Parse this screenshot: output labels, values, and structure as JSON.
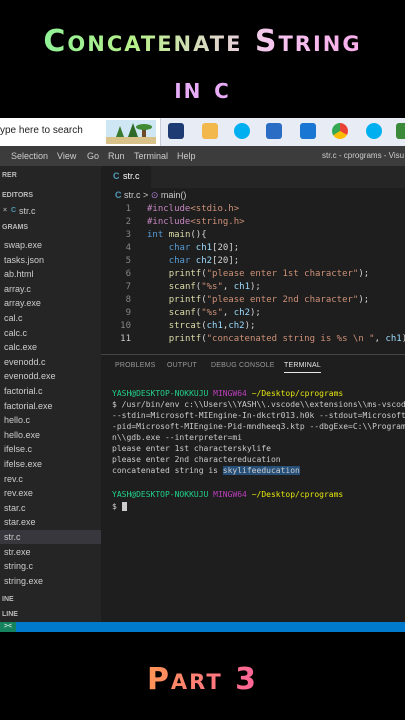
{
  "overlay": {
    "title_line1": "Concatenate String",
    "title_line2": "in c",
    "footer": "Part 3"
  },
  "taskbar": {
    "search_placeholder": "ype here to search",
    "icons": [
      "task-view-icon",
      "file-explorer-icon",
      "skype-icon",
      "calendar-icon",
      "mail-icon",
      "chrome-icon",
      "skype-icon",
      "app-icon"
    ]
  },
  "menubar": {
    "items": [
      "Selection",
      "View",
      "Go",
      "Run",
      "Terminal",
      "Help"
    ],
    "window_title": "str.c - cprograms - Visu"
  },
  "sidebar": {
    "header": "RER",
    "open_editors": "EDITORS",
    "open_file": "str.c",
    "folder": "GRAMS",
    "files": [
      "swap.exe",
      "tasks.json",
      "ab.html",
      "array.c",
      "array.exe",
      "cal.c",
      "calc.c",
      "calc.exe",
      "evenodd.c",
      "evenodd.exe",
      "factorial.c",
      "factorial.exe",
      "hello.c",
      "hello.exe",
      "ifelse.c",
      "ifelse.exe",
      "rev.c",
      "rev.exe",
      "star.c",
      "star.exe",
      "str.c",
      "str.exe",
      "string.c",
      "string.exe"
    ],
    "outline": "INE",
    "timeline": "LINE"
  },
  "editor": {
    "tab_label": "str.c",
    "breadcrumb_file": "str.c",
    "breadcrumb_sep": ">",
    "breadcrumb_symbol": "main()",
    "lines": [
      "8",
      "9",
      "10",
      "11"
    ]
  },
  "panel": {
    "tabs": [
      "PROBLEMS",
      "OUTPUT",
      "DEBUG CONSOLE",
      "TERMINAL"
    ]
  },
  "terminal": {
    "prompt_user": "YASH@DESKTOP-NOKKUJU",
    "prompt_shell": "MINGW64",
    "prompt_path": "~/Desktop/cprograms",
    "cmd1": "$ /usr/bin/env c:\\\\Users\\\\YASH\\\\.vscode\\\\extensions\\\\ms-vscod",
    "cmd2": "--stdin=Microsoft-MIEngine-In-dkctr013.h0k --stdout=Microsoft-",
    "cmd3": "-pid=Microsoft-MIEngine-Pid-mndheeq3.ktp --dbgExe=C:\\\\Program\\",
    "cmd4": "n\\\\gdb.exe --interpreter=mi",
    "out1": "please enter 1st characterskylife",
    "out2": "please enter 2nd charactereducation",
    "out3_prefix": "concatenated string is ",
    "out3_value": "skylifeeducation",
    "prompt2": "$"
  },
  "statusbar": {
    "remote_label": "><"
  }
}
